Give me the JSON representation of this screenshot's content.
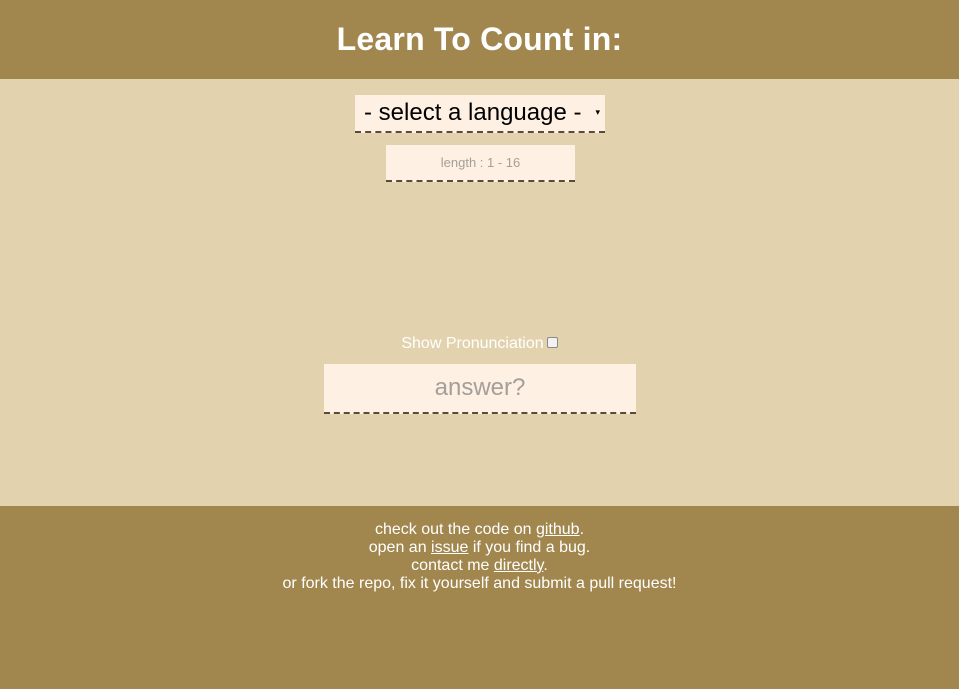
{
  "header": {
    "title": "Learn To Count in:"
  },
  "language_select": {
    "selected": "- select a language -",
    "arrow_icon": "▾"
  },
  "length_input": {
    "value": "",
    "placeholder": "length : 1 - 16"
  },
  "pronunciation": {
    "label": "Show Pronunciation",
    "checked": false
  },
  "answer_input": {
    "value": "",
    "placeholder": "answer?"
  },
  "footer": {
    "line1": {
      "before": "check out the code on ",
      "link": "github",
      "after": "."
    },
    "line2": {
      "before": "open an ",
      "link": "issue",
      "after": " if you find a bug."
    },
    "line3": {
      "before": "contact me ",
      "link": "directly",
      "after": "."
    },
    "line4": {
      "text": "or fork the repo, fix it yourself and submit a pull request!"
    }
  },
  "colors": {
    "header_bg": "#a1864e",
    "page_bg": "#e2d3ae",
    "input_bg": "#fef0e2",
    "text_light": "#ffffff"
  }
}
